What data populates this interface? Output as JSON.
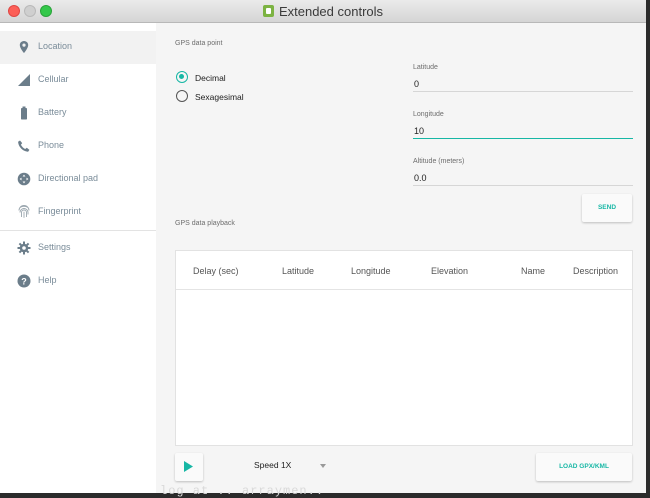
{
  "window": {
    "title": "Extended controls"
  },
  "sidebar": {
    "items": [
      {
        "label": "Location",
        "icon": "location-pin-icon",
        "active": true
      },
      {
        "label": "Cellular",
        "icon": "signal-icon"
      },
      {
        "label": "Battery",
        "icon": "battery-icon"
      },
      {
        "label": "Phone",
        "icon": "phone-icon"
      },
      {
        "label": "Directional pad",
        "icon": "dpad-icon"
      },
      {
        "label": "Fingerprint",
        "icon": "fingerprint-icon"
      },
      {
        "label": "Settings",
        "icon": "gear-icon"
      },
      {
        "label": "Help",
        "icon": "help-icon"
      }
    ]
  },
  "gps": {
    "section_label": "GPS data point",
    "format_options": [
      "Decimal",
      "Sexagesimal"
    ],
    "selected_format": "Decimal",
    "latitude": {
      "label": "Latitude",
      "value": "0"
    },
    "longitude": {
      "label": "Longitude",
      "value": "10"
    },
    "altitude": {
      "label": "Altitude (meters)",
      "value": "0.0"
    },
    "send_label": "SEND"
  },
  "playback": {
    "section_label": "GPS data playback",
    "columns": [
      "Delay (sec)",
      "Latitude",
      "Longitude",
      "Elevation",
      "Name",
      "Description"
    ],
    "speed": "Speed 1X",
    "load_label": "LOAD GPX/KML"
  },
  "background_text": "log at ..  arraymen.."
}
